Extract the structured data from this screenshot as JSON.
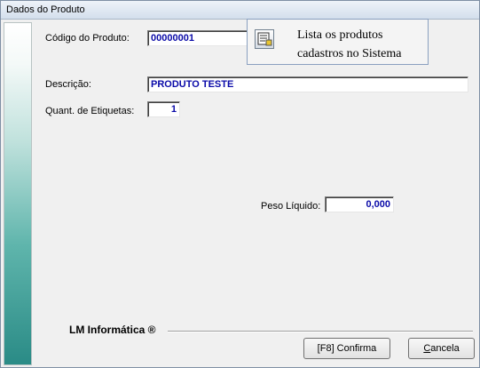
{
  "window": {
    "title": "Dados do Produto"
  },
  "form": {
    "codigo_label": "Código do Produto:",
    "codigo_value": "00000001",
    "descricao_label": "Descrição:",
    "descricao_value": "PRODUTO TESTE",
    "etiquetas_label": "Quant. de Etiquetas:",
    "etiquetas_value": "1",
    "peso_label": "Peso Líquido:",
    "peso_value": "0,000"
  },
  "tooltip": {
    "line1": "Lista os produtos",
    "line2": "cadastros no Sistema",
    "icon": "product-list-icon"
  },
  "footer": {
    "brand": "LM Informática ®",
    "confirm_label": "[F8]   Confirma",
    "cancel_accel": "C",
    "cancel_rest": "ancela"
  },
  "colors": {
    "field_text": "#0a0aa8",
    "sidebar_dark": "#2a8b86"
  }
}
